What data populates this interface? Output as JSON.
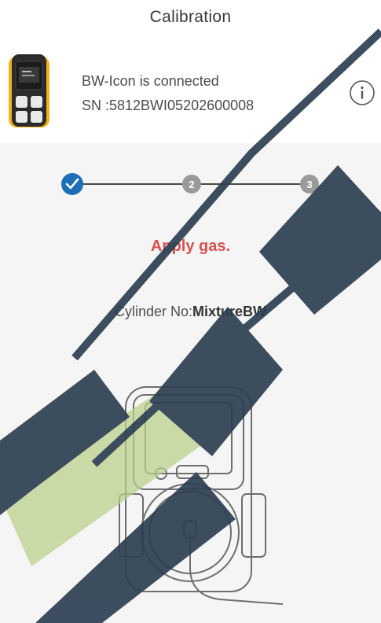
{
  "header": {
    "title": "Calibration"
  },
  "device": {
    "status": "BW-Icon is connected",
    "serial": "SN :5812BWI05202600008"
  },
  "stepper": {
    "steps": [
      {
        "label": "",
        "state": "done"
      },
      {
        "label": "2",
        "state": "active"
      },
      {
        "label": "3",
        "state": "pending"
      }
    ]
  },
  "status_message": "Apply gas.",
  "cylinder": {
    "prefix": "Cylinder No:",
    "value": "MixtureBW"
  },
  "colors": {
    "accent_blue": "#1f6fb8",
    "alert_red": "#d9504f",
    "device_yellow": "#f2b21b",
    "watermark_dark": "#2d3f52",
    "watermark_green": "#b9cf8a"
  },
  "icons": {
    "step_done": "checkmark-icon",
    "info": "info-icon"
  }
}
